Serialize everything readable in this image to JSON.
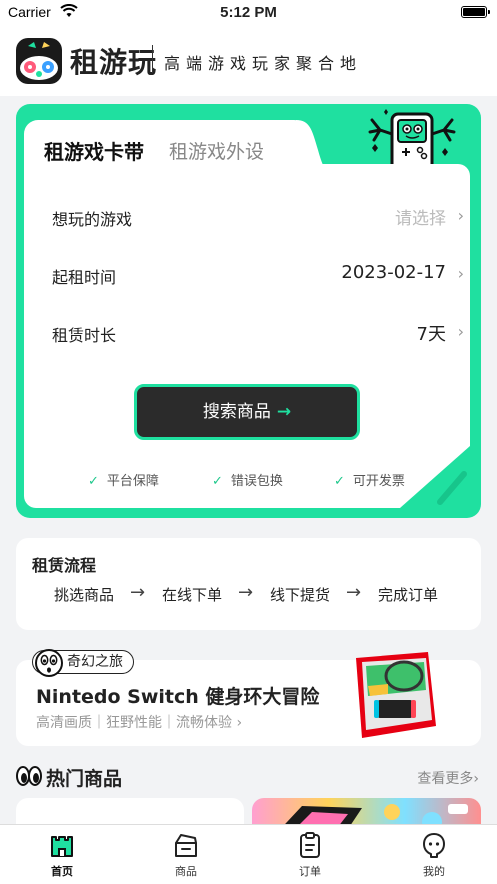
{
  "status": {
    "carrier": "Carrier",
    "time": "5:12 PM"
  },
  "header": {
    "logo_text": "租游玩",
    "slogan": "高端游戏玩家聚合地"
  },
  "rent": {
    "tabs": [
      {
        "label": "租游戏卡带",
        "active": true
      },
      {
        "label": "租游戏外设",
        "active": false
      }
    ],
    "rows": [
      {
        "label": "想玩的游戏",
        "value": "请选择",
        "placeholder": true
      },
      {
        "label": "起租时间",
        "value": "2023-02-17",
        "placeholder": false
      },
      {
        "label": "租赁时长",
        "value": "7天",
        "placeholder": false
      }
    ],
    "search_label": "搜索商品",
    "guarantees": [
      "平台保障",
      "错误包换",
      "可开发票"
    ]
  },
  "process": {
    "title": "租赁流程",
    "steps": [
      "挑选商品",
      "在线下单",
      "线下提货",
      "完成订单"
    ]
  },
  "promo": {
    "badge": "奇幻之旅",
    "title": "Nintedo Switch 健身环大冒险",
    "subtitle": "高清画质｜狂野性能｜流畅体验"
  },
  "hot": {
    "title": "热门商品",
    "more": "查看更多"
  },
  "tabbar": [
    {
      "label": "首页",
      "icon": "castle-icon",
      "active": true
    },
    {
      "label": "商品",
      "icon": "box-icon",
      "active": false
    },
    {
      "label": "订单",
      "icon": "clipboard-icon",
      "active": false
    },
    {
      "label": "我的",
      "icon": "profile-icon",
      "active": false
    }
  ],
  "colors": {
    "accent": "#1fe0a0",
    "dark_button": "#2b2b2b",
    "background": "#f2f3f5"
  }
}
